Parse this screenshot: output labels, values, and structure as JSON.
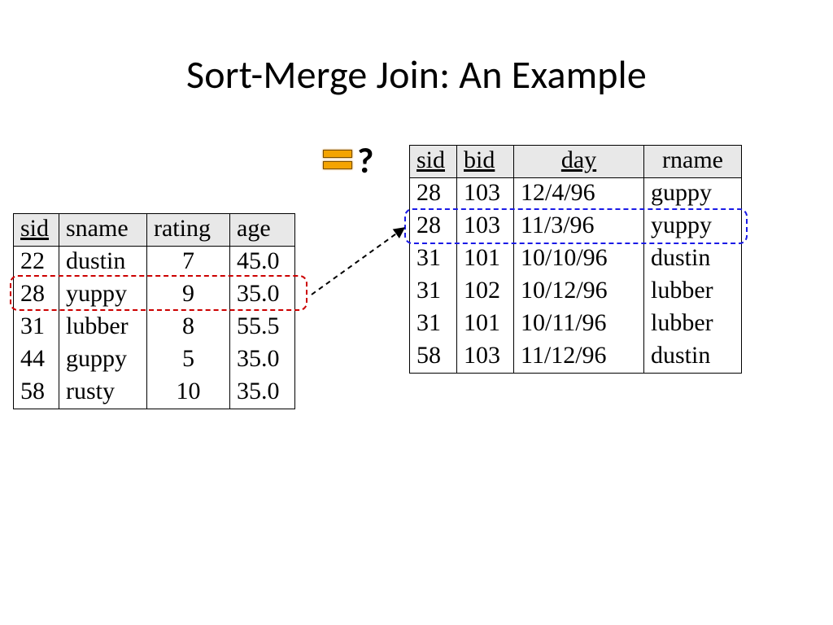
{
  "title": "Sort-Merge Join: An Example",
  "question_mark": "?",
  "sailors": {
    "headers": {
      "sid": "sid",
      "sname": "sname",
      "rating": "rating",
      "age": "age"
    },
    "rows": [
      {
        "sid": "22",
        "sname": "dustin",
        "rating": "7",
        "age": "45.0"
      },
      {
        "sid": "28",
        "sname": "yuppy",
        "rating": "9",
        "age": "35.0"
      },
      {
        "sid": "31",
        "sname": "lubber",
        "rating": "8",
        "age": "55.5"
      },
      {
        "sid": "44",
        "sname": "guppy",
        "rating": "5",
        "age": "35.0"
      },
      {
        "sid": "58",
        "sname": "rusty",
        "rating": "10",
        "age": "35.0"
      }
    ]
  },
  "reserves": {
    "headers": {
      "sid": "sid",
      "bid": "bid",
      "day": "day",
      "rname": "rname"
    },
    "rows": [
      {
        "sid": "28",
        "bid": "103",
        "day": "12/4/96",
        "rname": "guppy"
      },
      {
        "sid": "28",
        "bid": "103",
        "day": "11/3/96",
        "rname": "yuppy"
      },
      {
        "sid": "31",
        "bid": "101",
        "day": "10/10/96",
        "rname": "dustin"
      },
      {
        "sid": "31",
        "bid": "102",
        "day": "10/12/96",
        "rname": "lubber"
      },
      {
        "sid": "31",
        "bid": "101",
        "day": "10/11/96",
        "rname": "lubber"
      },
      {
        "sid": "58",
        "bid": "103",
        "day": "11/12/96",
        "rname": "dustin"
      }
    ]
  },
  "annotations": {
    "equals_color": "#f4a400",
    "left_highlight_color": "#cc0000",
    "right_highlight_color": "#1a1ae6",
    "left_highlight_row_index": 1,
    "right_highlight_row_index": 1
  }
}
